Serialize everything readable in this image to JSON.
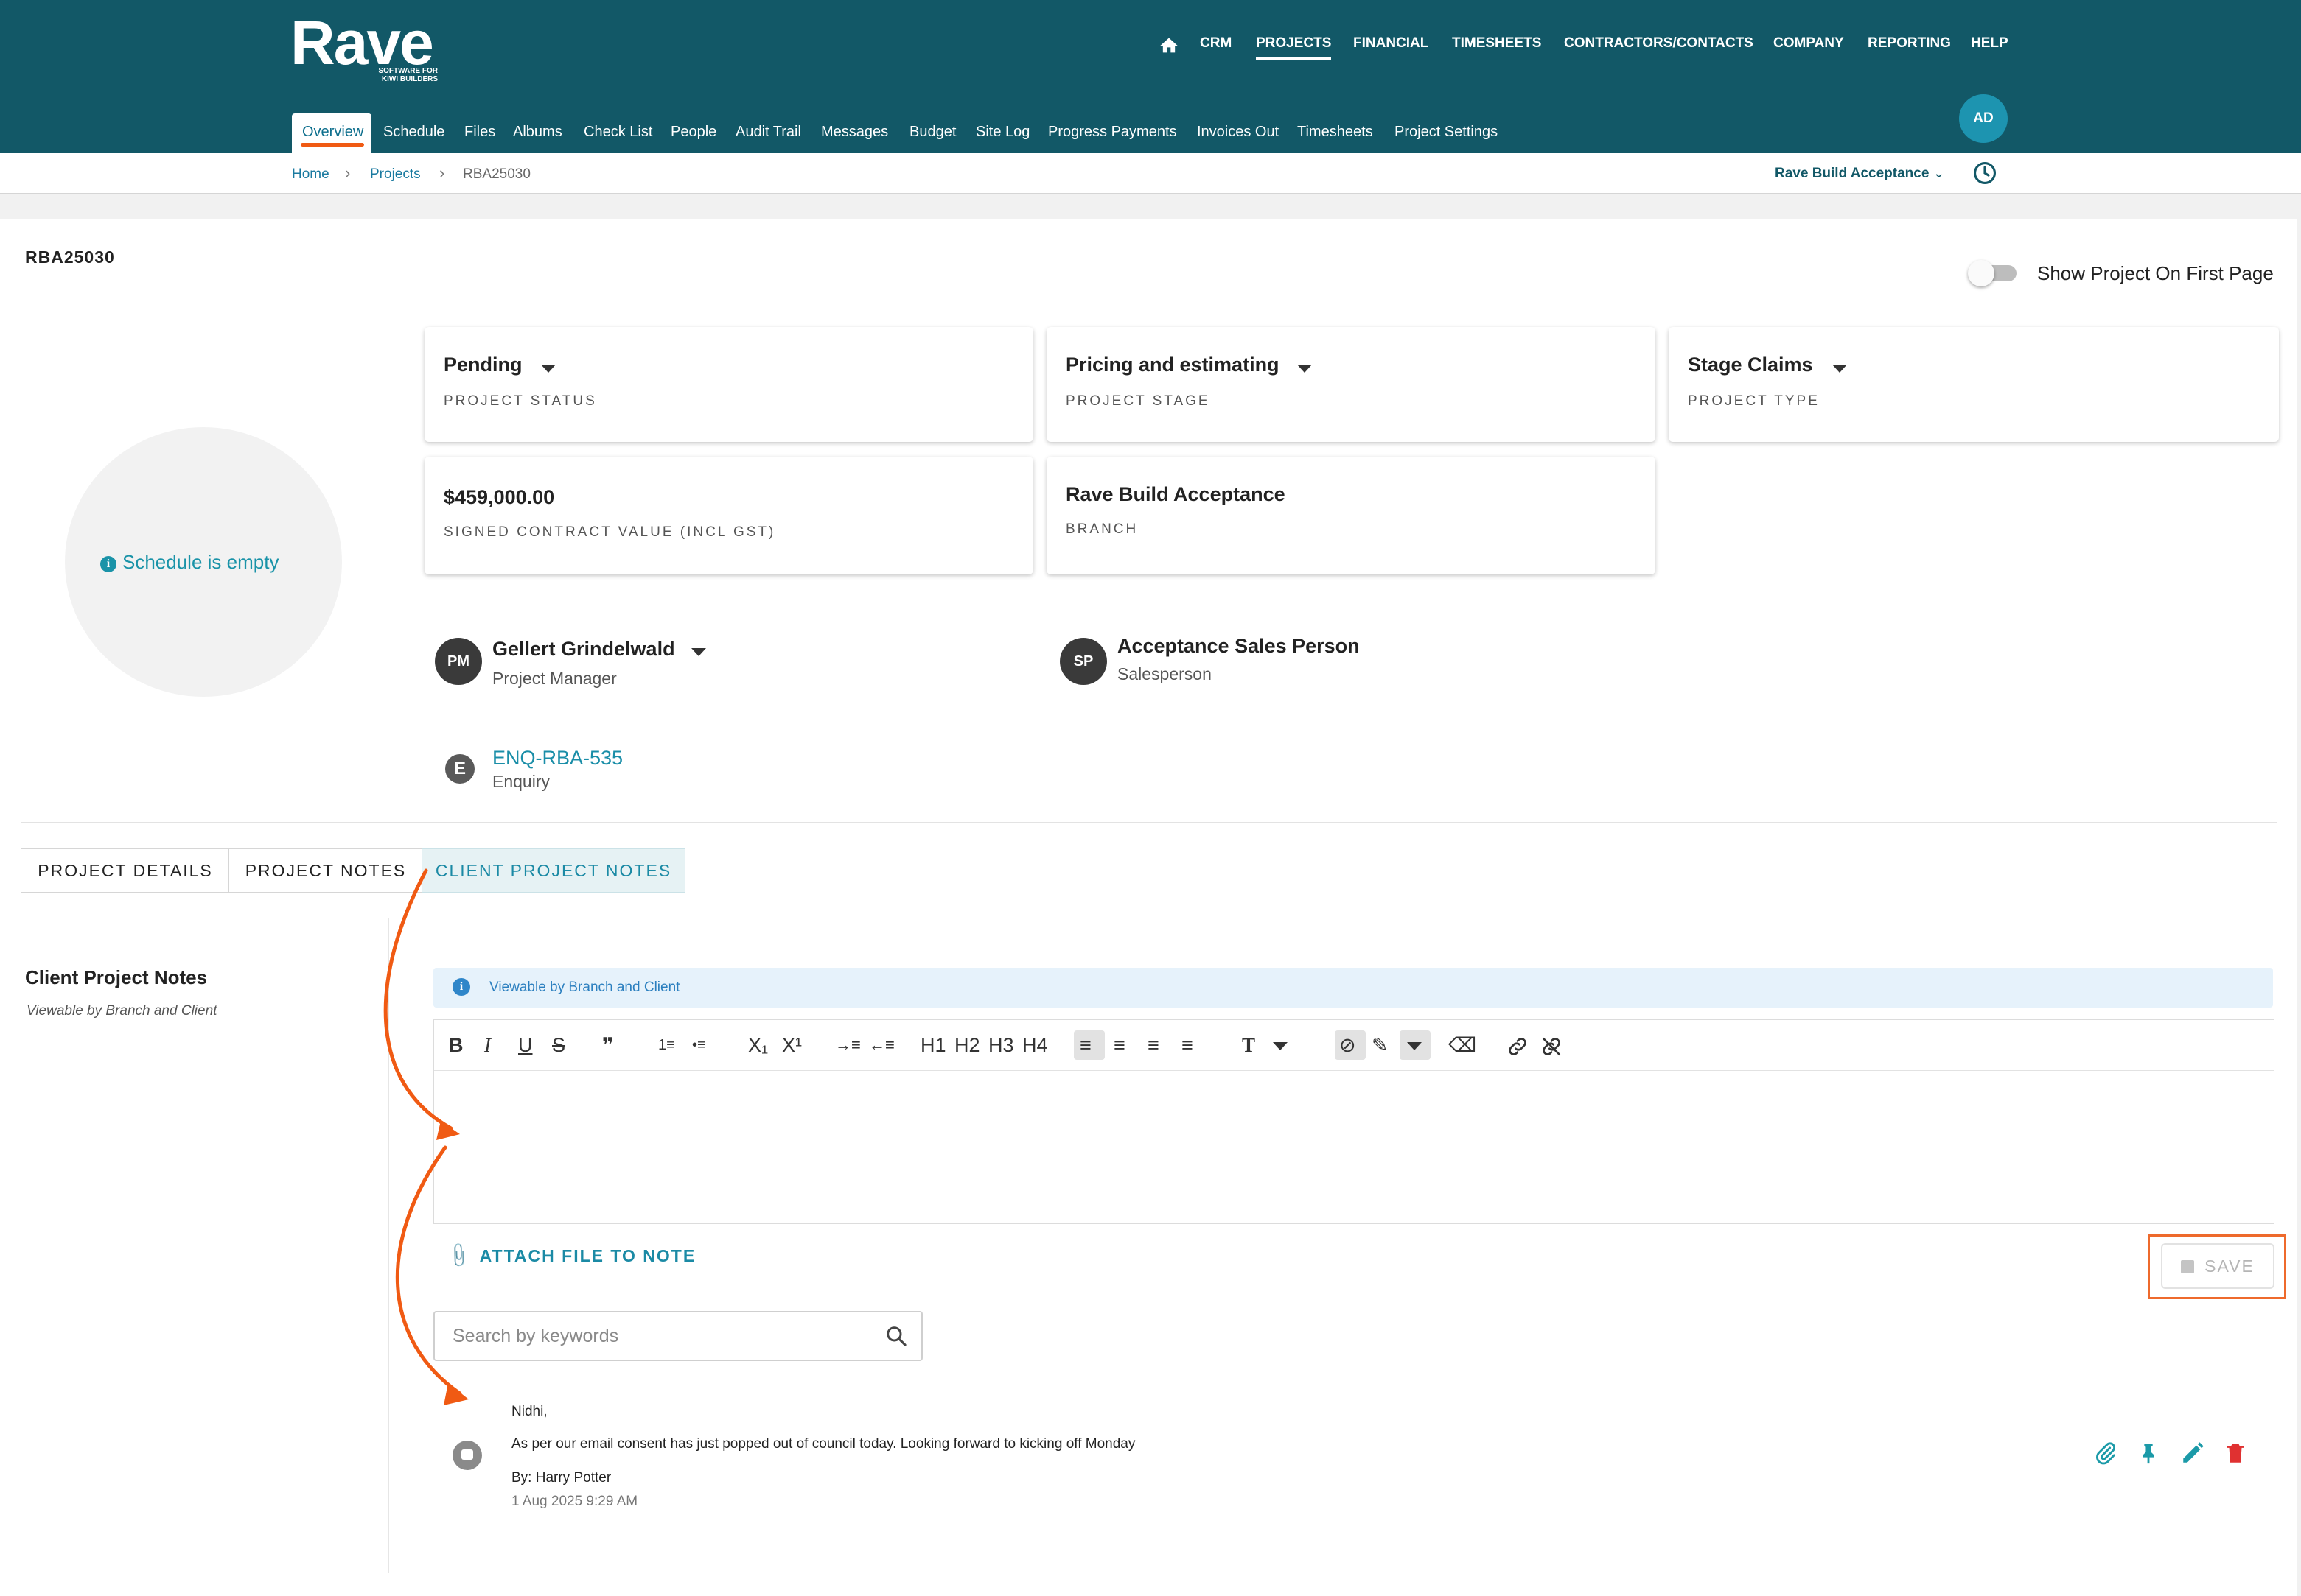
{
  "brand": {
    "logo": "Rave",
    "tagline": "SOFTWARE FOR KIWI BUILDERS"
  },
  "topnav": [
    "CRM",
    "PROJECTS",
    "FINANCIAL",
    "TIMESHEETS",
    "CONTRACTORS/CONTACTS",
    "COMPANY",
    "REPORTING",
    "HELP"
  ],
  "subnav": [
    "Overview",
    "Schedule",
    "Files",
    "Albums",
    "Check List",
    "People",
    "Audit Trail",
    "Messages",
    "Budget",
    "Site Log",
    "Progress Payments",
    "Invoices Out",
    "Timesheets",
    "Project Settings"
  ],
  "user": {
    "initials": "AD"
  },
  "breadcrumb": {
    "home": "Home",
    "projects": "Projects",
    "current": "RBA25030"
  },
  "branch_selector": "Rave Build Acceptance",
  "project": {
    "code": "RBA25030",
    "show_first_page_label": "Show Project On First Page",
    "show_first_page": false,
    "schedule_empty": "Schedule is empty",
    "status": {
      "value": "Pending",
      "label": "PROJECT STATUS"
    },
    "stage": {
      "value": "Pricing and estimating",
      "label": "PROJECT STAGE"
    },
    "type": {
      "value": "Stage Claims",
      "label": "PROJECT TYPE"
    },
    "contract": {
      "value": "$459,000.00",
      "label": "SIGNED CONTRACT VALUE (INCL GST)"
    },
    "branch": {
      "value": "Rave Build Acceptance",
      "label": "BRANCH"
    }
  },
  "people": {
    "pm": {
      "initials": "PM",
      "name": "Gellert Grindelwald",
      "role": "Project Manager"
    },
    "sp": {
      "initials": "SP",
      "name": "Acceptance Sales Person",
      "role": "Salesperson"
    },
    "enquiry": {
      "initial": "E",
      "code": "ENQ-RBA-535",
      "label": "Enquiry"
    }
  },
  "tabs": [
    "PROJECT DETAILS",
    "PROJECT NOTES",
    "CLIENT PROJECT NOTES"
  ],
  "notes": {
    "heading": "Client Project Notes",
    "subheading": "Viewable by Branch and Client",
    "banner": "Viewable by Branch and Client",
    "toolbar": [
      "B",
      "I",
      "U",
      "S",
      "❞",
      "1≡",
      "•≡",
      "X₁",
      "X¹",
      "→≡",
      "←≡",
      "H1",
      "H2",
      "H3",
      "H4",
      "≡",
      "≡",
      "≡",
      "≡",
      "T",
      "⊘",
      "✎",
      "⌫"
    ],
    "attach_label": "ATTACH FILE TO NOTE",
    "save_label": "SAVE",
    "search_placeholder": "Search by keywords",
    "items": [
      {
        "greeting": "Nidhi,",
        "body": "As per our email consent has just popped out of council today. Looking forward to kicking off Monday",
        "author": "By: Harry Potter",
        "time": "1 Aug 2025 9:29 AM"
      }
    ]
  },
  "colors": {
    "header": "#125867",
    "accent": "#1b8aa5",
    "highlight": "#ee6a2c",
    "delete": "#e03131"
  }
}
